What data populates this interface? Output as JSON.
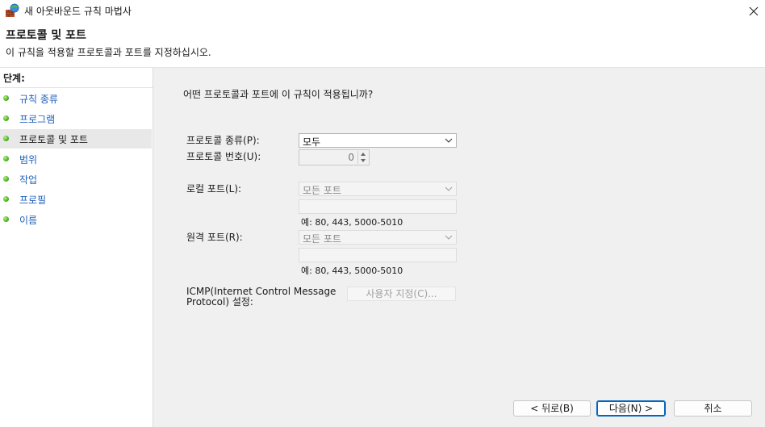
{
  "window": {
    "title": "새 아웃바운드 규칙 마법사",
    "icon": "firewall-shield-icon"
  },
  "header": {
    "title": "프로토콜 및 포트",
    "subtitle": "이 규칙을 적용할 프로토콜과 포트를 지정하십시오."
  },
  "steps": {
    "heading": "단계:",
    "items": [
      {
        "label": "규칙 종류",
        "active": false
      },
      {
        "label": "프로그램",
        "active": false
      },
      {
        "label": "프로토콜 및 포트",
        "active": true
      },
      {
        "label": "범위",
        "active": false
      },
      {
        "label": "작업",
        "active": false
      },
      {
        "label": "프로필",
        "active": false
      },
      {
        "label": "이름",
        "active": false
      }
    ]
  },
  "form": {
    "question": "어떤 프로토콜과 포트에 이 규칙이 적용됩니까?",
    "protocol_type": {
      "label": "프로토콜 종류(P):",
      "value": "모두"
    },
    "protocol_number": {
      "label": "프로토콜 번호(U):",
      "value": "0"
    },
    "local_port": {
      "label": "로컬 포트(L):",
      "value": "모든 포트",
      "text": "",
      "hint": "예: 80, 443, 5000-5010"
    },
    "remote_port": {
      "label": "원격 포트(R):",
      "value": "모든 포트",
      "text": "",
      "hint": "예: 80, 443, 5000-5010"
    },
    "icmp": {
      "label_line1": "ICMP(Internet Control Message",
      "label_line2": "Protocol) 설정:",
      "button": "사용자 지정(C)..."
    }
  },
  "buttons": {
    "back": "< 뒤로(B)",
    "next": "다음(N) >",
    "cancel": "취소"
  },
  "colors": {
    "link": "#1f5fb8",
    "accent": "#0067c0",
    "step_dot": "#4db31e"
  }
}
